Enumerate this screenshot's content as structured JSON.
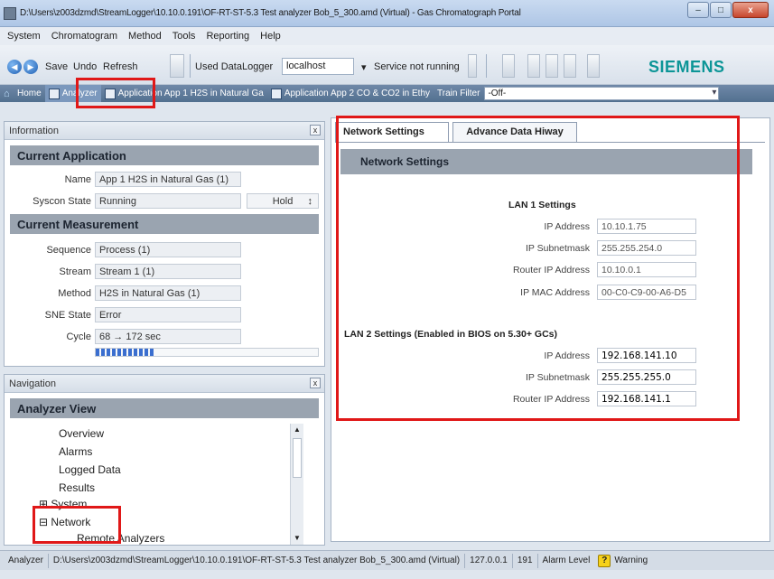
{
  "window": {
    "title": "D:\\Users\\z003dzmd\\StreamLogger\\10.10.0.191\\OF-RT-ST-5.3 Test analyzer Bob_5_300.amd (Virtual) - Gas Chromatograph Portal",
    "minimize": "–",
    "maximize": "□",
    "close": "x"
  },
  "menu": [
    "System",
    "Chromatogram",
    "Method",
    "Tools",
    "Reporting",
    "Help"
  ],
  "toolbar": {
    "save": "Save",
    "undo": "Undo",
    "refresh": "Refresh",
    "used_datalogger_label": "Used DataLogger",
    "datalogger_value": "localhost",
    "service_status": "Service not running",
    "brand": "SIEMENS"
  },
  "tabstrip": {
    "home": "Home",
    "analyzer": "Analyzer",
    "app1": "Application  App 1 H2S in Natural Ga",
    "app2": "Application  App 2 CO & CO2 in Ethy",
    "train_filter_label": "Train Filter",
    "train_filter_value": "-Off-"
  },
  "information": {
    "panel_title": "Information",
    "close": "x",
    "current_application": {
      "heading": "Current Application",
      "name_label": "Name",
      "name_value": "App 1 H2S in Natural Gas (1)",
      "syscon_label": "Syscon State",
      "syscon_value": "Running",
      "hold_label": "Hold"
    },
    "current_measurement": {
      "heading": "Current Measurement",
      "sequence_label": "Sequence",
      "sequence_value": "Process (1)",
      "stream_label": "Stream",
      "stream_value": "Stream 1 (1)",
      "method_label": "Method",
      "method_value": "H2S in Natural Gas (1)",
      "sne_label": "SNE State",
      "sne_value": "Error",
      "cycle_label": "Cycle",
      "cycle_value": "68 → 172 sec",
      "cycle_progress": 0.27
    }
  },
  "navigation": {
    "panel_title": "Navigation",
    "close": "x",
    "heading": "Analyzer View",
    "items": [
      "Overview",
      "Alarms",
      "Logged Data",
      "Results"
    ],
    "system": "System",
    "network": "Network",
    "remote_analyzers": "Remote Analyzers"
  },
  "content": {
    "tabs": [
      "Network Settings",
      "Advance Data Hiway"
    ],
    "section_title": "Network Settings",
    "lan1": {
      "heading": "LAN 1 Settings",
      "ip_label": "IP Address",
      "ip_value": "10.10.1.75",
      "subnet_label": "IP Subnetmask",
      "subnet_value": "255.255.254.0",
      "router_label": "Router IP Address",
      "router_value": "10.10.0.1",
      "mac_label": "IP MAC Address",
      "mac_value": "00-C0-C9-00-A6-D5"
    },
    "lan2": {
      "heading": "LAN 2 Settings (Enabled in BIOS on 5.30+ GCs)",
      "ip_label": "IP Address",
      "ip_value": "192.168.141.10",
      "subnet_label": "IP Subnetmask",
      "subnet_value": "255.255.255.0",
      "router_label": "Router IP Address",
      "router_value": "192.168.141.1"
    }
  },
  "statusbar": {
    "mode": "Analyzer",
    "path": "D:\\Users\\z003dzmd\\StreamLogger\\10.10.0.191\\OF-RT-ST-5.3 Test analyzer Bob_5_300.amd (Virtual)",
    "ip": "127.0.0.1",
    "id": "191",
    "alarm_label": "Alarm Level",
    "alarm_icon": "?",
    "alarm_value": "Warning"
  }
}
